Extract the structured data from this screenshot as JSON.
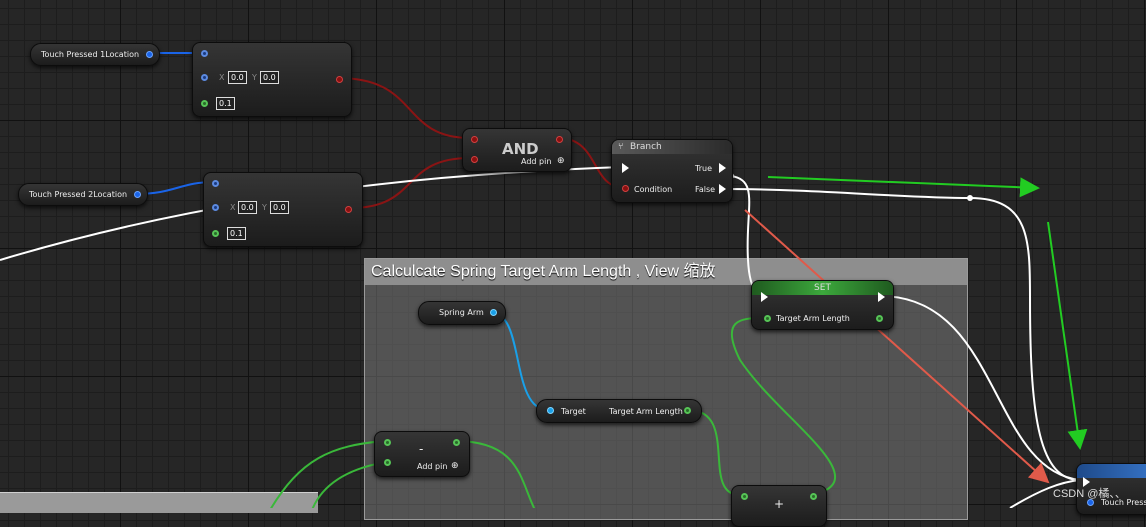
{
  "nodes": {
    "touch1": {
      "label": "Touch Pressed 1Location"
    },
    "touch2": {
      "label": "Touch Pressed 2Location"
    },
    "vec1": {
      "x_label": "X",
      "x_value": "0.0",
      "y_label": "Y",
      "y_value": "0.0",
      "tolerance": "0.1"
    },
    "vec2": {
      "x_label": "X",
      "x_value": "0.0",
      "y_label": "Y",
      "y_value": "0.0",
      "tolerance": "0.1"
    },
    "and": {
      "title": "AND",
      "add_pin": "Add pin"
    },
    "branch": {
      "title": "Branch",
      "true_label": "True",
      "false_label": "False",
      "condition_label": "Condition"
    },
    "comment": {
      "title": "Calculcate Spring Target Arm Length , View 缩放"
    },
    "spring_arm": {
      "label": "Spring Arm"
    },
    "getter": {
      "target_label": "Target",
      "output_label": "Target Arm Length"
    },
    "set": {
      "title": "SET",
      "input_label": "Target Arm Length"
    },
    "minus": {
      "title": "-",
      "add_pin": "Add pin"
    },
    "plus": {
      "title": "+"
    },
    "right_node": {
      "label": "Touch Pressed"
    }
  },
  "watermark": "CSDN @橘、、",
  "colors": {
    "exec_wire": "#ffffff",
    "bool_wire": "#8a1414",
    "vector_wire": "#1a64e8",
    "float_wire": "#3ab83a",
    "object_wire": "#1aa0e8",
    "green_arrow": "#22cc22",
    "red_arrow": "#e05a4a"
  }
}
